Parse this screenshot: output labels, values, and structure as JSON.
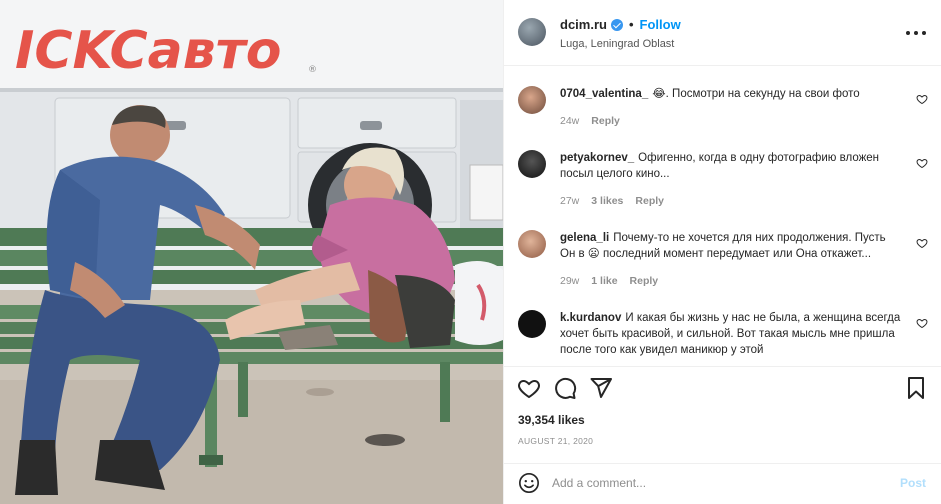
{
  "photo": {
    "logo": "ICKCавто",
    "registered_mark": "®"
  },
  "post": {
    "username": "dcim.ru",
    "separator": "•",
    "follow_label": "Follow",
    "location": "Luga, Leningrad Oblast",
    "verified": true
  },
  "comments": [
    {
      "username": "0704_valentina_",
      "emoji": "😂",
      "text": ". Посмотри на секунду на свои фото",
      "time": "24w",
      "likes": "",
      "reply_label": "Reply"
    },
    {
      "username": "petyakornev_",
      "emoji": "",
      "text": "Офигенно, когда в одну фотографию вложен посыл целого кино...",
      "time": "27w",
      "likes": "3 likes",
      "reply_label": "Reply"
    },
    {
      "username": "gelena_li",
      "emoji": "",
      "text": "Почему-то не хочется для них продолжения. Пусть Он в 😦 последний момент передумает или Она откажет...",
      "time": "29w",
      "likes": "1 like",
      "reply_label": "Reply"
    },
    {
      "username": "k.kurdanov",
      "emoji": "",
      "text": "И какая бы жизнь у нас не была, а женщина всегда хочет быть красивой, и сильной. Вот такая мысль мне пришла после того как увидел маникюр у этой",
      "time": "",
      "likes": "",
      "reply_label": ""
    }
  ],
  "actions": {
    "likes_count": "39,354 likes",
    "date": "AUGUST 21, 2020",
    "comment_placeholder": "Add a comment...",
    "post_label": "Post"
  },
  "colors": {
    "accent": "#0095f6",
    "post_disabled": "#b2dffc",
    "muted": "#8e8e8e",
    "text": "#262626",
    "logo_red": "#e5544a"
  },
  "icons": [
    "heart-icon",
    "comment-icon",
    "share-icon",
    "bookmark-icon",
    "more-icon",
    "emoji-icon",
    "verified-badge-icon"
  ]
}
